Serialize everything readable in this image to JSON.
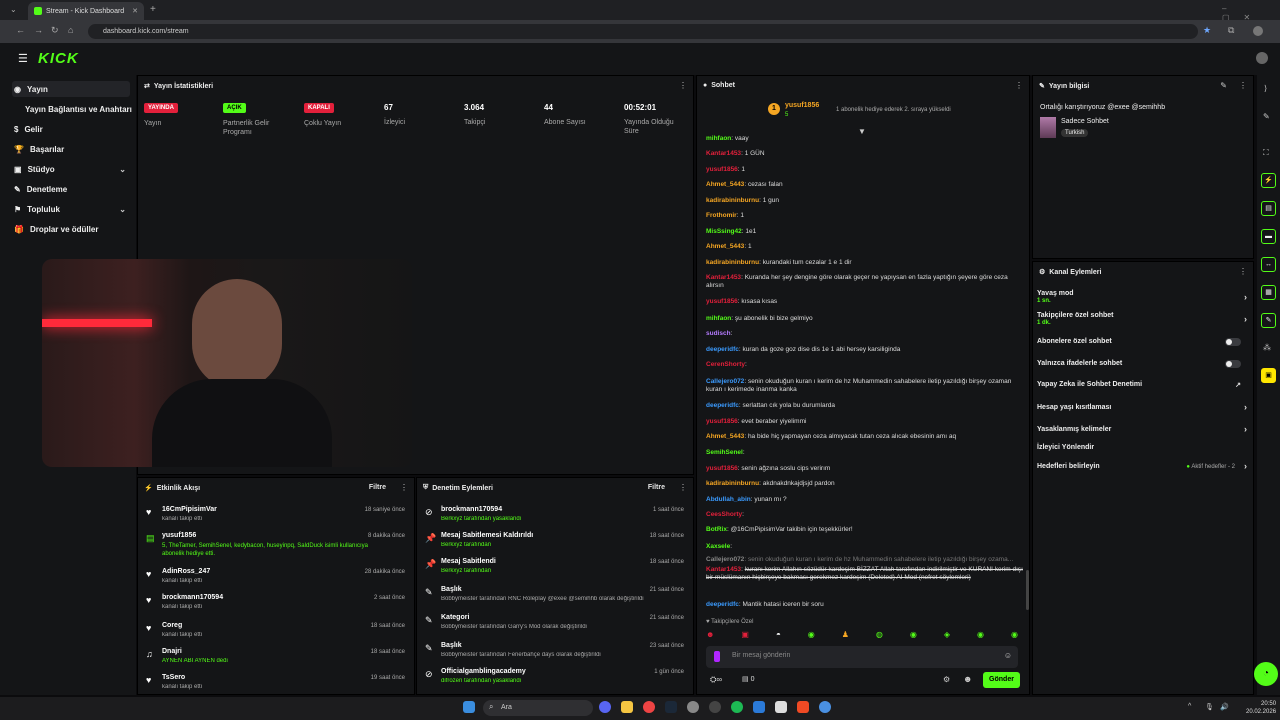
{
  "browser": {
    "tab_title": "Stream - Kick Dashboard",
    "url": "dashboard.kick.com/stream"
  },
  "app": {
    "logo": "KICK"
  },
  "sidebar": {
    "items": [
      {
        "label": "Yayın",
        "icon": "broadcast-icon"
      },
      {
        "label": "Yayın Bağlantısı ve Anahtarı",
        "icon": ""
      },
      {
        "label": "Gelir",
        "icon": "money-icon"
      },
      {
        "label": "Başarılar",
        "icon": "trophy-icon"
      },
      {
        "label": "Stüdyo",
        "icon": "studio-icon"
      },
      {
        "label": "Denetleme",
        "icon": "wrench-icon"
      },
      {
        "label": "Topluluk",
        "icon": "community-icon"
      },
      {
        "label": "Droplar ve ödüller",
        "icon": "gift-icon"
      }
    ]
  },
  "stats": {
    "title": "Yayın İstatistikleri",
    "items": [
      {
        "value": "YAYINDA",
        "label": "Yayın",
        "badge_color": "#e3203b"
      },
      {
        "value": "AÇIK",
        "label": "Partnerlik Gelir Programı",
        "badge_color": "#53fc18"
      },
      {
        "value": "KAPALI",
        "label": "Çoklu Yayın",
        "badge_color": "#e3203b"
      },
      {
        "value": "67",
        "label": "İzleyici"
      },
      {
        "value": "3.064",
        "label": "Takipçi"
      },
      {
        "value": "44",
        "label": "Abone Sayısı"
      },
      {
        "value": "00:52:01",
        "label": "Yayında Olduğu Süre"
      }
    ]
  },
  "activity": {
    "title": "Etkinlik Akışı",
    "filter": "Filtre",
    "rows": [
      {
        "name": "16CmPipisimVar",
        "sub": "kanalı takip etti",
        "time": "18 saniye önce"
      },
      {
        "name": "yusuf1856",
        "sub": "5, TheTamer, SemihSenel, kedybacon, huseyinpq, SaldDuck isimli kullanıcıya abonelik hediye etti.",
        "time": "8 dakika önce"
      },
      {
        "name": "AdinRoss_247",
        "sub": "kanalı takip etti",
        "time": "28 dakika önce"
      },
      {
        "name": "brockmann170594",
        "sub": "kanalı takip etti",
        "time": "2 saat önce"
      },
      {
        "name": "Coreg",
        "sub": "kanalı takip etti",
        "time": "18 saat önce"
      },
      {
        "name": "Dnajri",
        "sub": "AYNEN ABİ AYNEN dedi",
        "time": "18 saat önce"
      },
      {
        "name": "TsSero",
        "sub": "kanalı takip etti",
        "time": "19 saat önce"
      }
    ]
  },
  "moderation": {
    "title": "Denetim Eylemleri",
    "filter": "Filtre",
    "rows": [
      {
        "name": "brockmann170594",
        "sub": "Berkxyz tarafından yasaklandı",
        "time": "1 saat önce"
      },
      {
        "name": "Mesaj Sabitlemesi Kaldırıldı",
        "sub": "Berkxyz tarafından",
        "time": "18 saat önce"
      },
      {
        "name": "Mesaj Sabitlendi",
        "sub": "Berkxyz tarafından",
        "time": "18 saat önce"
      },
      {
        "name": "Başlık",
        "sub": "Bobbymeister tarafından RNC Roleplay @exee @semihhb olarak değiştirildi",
        "time": "21 saat önce"
      },
      {
        "name": "Kategori",
        "sub": "Bobbymeister tarafından Garry's Mod olarak değiştirildi",
        "time": "21 saat önce"
      },
      {
        "name": "Başlık",
        "sub": "Bobbymeister tarafından Fenerbahçe days olarak değiştirildi",
        "time": "23 saat önce"
      },
      {
        "name": "Officialgamblingacademy",
        "sub": "difrozen tarafından yasaklandı",
        "time": "1 gün önce"
      }
    ]
  },
  "chat": {
    "title": "Sohbet",
    "pinned_user": "yusuf1856",
    "pinned_count": "5",
    "pinned_text": "1 abonelik hediye ederek 2. sıraya yükseldi",
    "lines": [
      {
        "user": "mihfaon",
        "color": "#53fc18",
        "text": "vaay"
      },
      {
        "user": "Kantar1453",
        "color": "#e3203b",
        "text": "1 GÜN"
      },
      {
        "user": "yusuf1856",
        "color": "#e3203b",
        "text": "1"
      },
      {
        "user": "Ahmet_5443",
        "color": "#f5a623",
        "text": "cezası falan"
      },
      {
        "user": "kadirabininburnu",
        "color": "#f5a623",
        "text": "1 gun"
      },
      {
        "user": "Frothomir",
        "color": "#f5a623",
        "text": "1"
      },
      {
        "user": "MisSsing42",
        "color": "#53fc18",
        "text": "1e1"
      },
      {
        "user": "Ahmet_5443",
        "color": "#f5a623",
        "text": "1"
      },
      {
        "user": "kadirabininburnu",
        "color": "#f5a623",
        "text": "kurandaki tum cezalar 1 e 1 dir"
      },
      {
        "user": "Kantar1453",
        "color": "#e3203b",
        "text": "Kuranda her şey dengine göre olarak geçer ne yapıysan en fazla yaptığın şeyere göre ceza alırsın"
      },
      {
        "user": "yusuf1856",
        "color": "#e3203b",
        "text": "kısasa kısas"
      },
      {
        "user": "mihfaon",
        "color": "#53fc18",
        "text": "şu abonelik bi bize gelmiyo"
      },
      {
        "user": "sudisch",
        "color": "#b57bff",
        "text": ""
      },
      {
        "user": "deeperidfc",
        "color": "#3b9bff",
        "text": "kuran da goze goz dise dis 1e 1 abi hersey karsiliginda"
      },
      {
        "user": "CerenShorty",
        "color": "#e3203b",
        "text": ""
      },
      {
        "user": "Callejero072",
        "color": "#3b9bff",
        "text": "senin okuduğun kuran ı kerim de hz Muhammedin sahabelere iletip yazıldığı birşey ozaman kuran ı kerimede inanma kanka"
      },
      {
        "user": "deeperidfc",
        "color": "#3b9bff",
        "text": "serlattan cık yola bu durumlarda"
      },
      {
        "user": "yusuf1856",
        "color": "#e3203b",
        "text": "evet beraber yiyelimmi"
      },
      {
        "user": "Ahmet_5443",
        "color": "#f5a623",
        "text": "ha bide hiç yapmayan ceza almıyacak tutan ceza alıcak ebesinin amı aq"
      },
      {
        "user": "SemihSenel",
        "color": "#53fc18",
        "text": ""
      },
      {
        "user": "yusuf1856",
        "color": "#e3203b",
        "text": "senin ağzına soslu cips verirım"
      },
      {
        "user": "kadirabininburnu",
        "color": "#f5a623",
        "text": "akdnakdnkajdjsjd pardon"
      },
      {
        "user": "Abdullah_abin",
        "color": "#3b9bff",
        "text": "yunan mı ?"
      },
      {
        "user": "CeesShorty",
        "color": "#e3203b",
        "text": ""
      },
      {
        "user": "BotRix",
        "color": "#53fc18",
        "text": "@16CmPipisimVar takibin için teşekkürler!"
      },
      {
        "user": "Xaxsele",
        "color": "#53fc18",
        "text": ""
      },
      {
        "user": "Callejero072",
        "color": "#888",
        "text": "senin okuduğun kuran ı kerim de hz Muhammedin sahabelere iletip yazıldığı birşey ozama..."
      },
      {
        "user": "Kantar1453",
        "color": "#e3203b",
        "text": "kuranı kerim Allahın sözüdür kardeşim BİZZAT Allah tarafından indirilmiştir ve KURANI kerim dışı bir müslümanın hiçbirşeye bakması gerekmez kardeşim (Deleted) AI Mod (nefret söylemleri)"
      },
      {
        "user": "deeperidfc",
        "color": "#3b9bff",
        "text": "Mantik hatasi iceren bir soru"
      }
    ],
    "followers_only": "Takipçilere Özel",
    "input_placeholder": "Bir mesaj gönderin",
    "points": "0",
    "send_label": "Gönder"
  },
  "stream_info": {
    "title": "Yayın bilgisi",
    "stream_title": "Ortalığı karıştırıyoruz @exee @semihhb",
    "category": "Sadece Sohbet",
    "tag": "Turkish"
  },
  "channel_actions": {
    "title": "Kanal Eylemleri",
    "items": [
      {
        "label": "Yavaş mod",
        "sub": "1 sn.",
        "type": "arrow"
      },
      {
        "label": "Takipçilere özel sohbet",
        "sub": "1 dk.",
        "type": "arrow"
      },
      {
        "label": "Abonelere özel sohbet",
        "sub": "",
        "type": "toggle"
      },
      {
        "label": "Yalnızca ifadelerle sohbet",
        "sub": "",
        "type": "toggle"
      },
      {
        "label": "Yapay Zeka ile Sohbet Denetimi",
        "sub": "",
        "type": "link"
      },
      {
        "label": "Hesap yaşı kısıtlaması",
        "sub": "",
        "type": "arrow"
      },
      {
        "label": "Yasaklanmış kelimeler",
        "sub": "",
        "type": "arrow"
      },
      {
        "label": "İzleyici Yönlendir",
        "sub": "",
        "type": "none"
      },
      {
        "label": "Hedefleri belirleyin",
        "sub": "",
        "type": "goal"
      }
    ],
    "goal_status": "Aktif hedefler - 2"
  },
  "taskbar": {
    "search": "Ara",
    "time": "20:50",
    "date": "20.02.2026"
  }
}
